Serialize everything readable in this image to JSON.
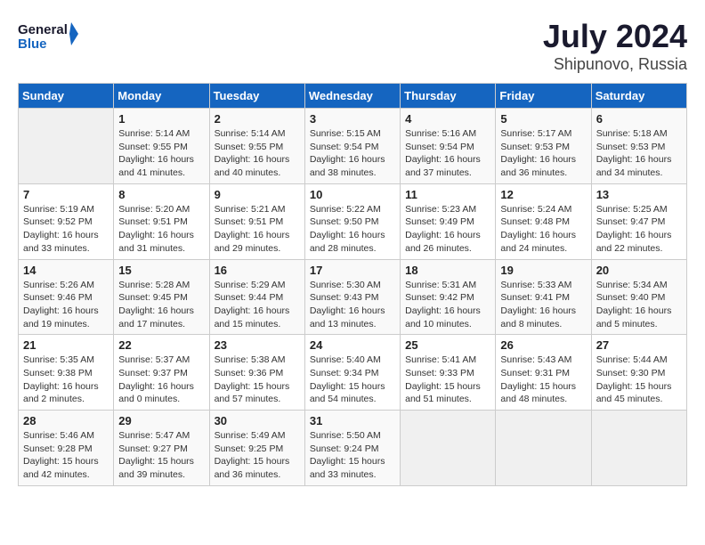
{
  "header": {
    "logo_line1": "General",
    "logo_line2": "Blue",
    "title": "July 2024",
    "subtitle": "Shipunovo, Russia"
  },
  "days_of_week": [
    "Sunday",
    "Monday",
    "Tuesday",
    "Wednesday",
    "Thursday",
    "Friday",
    "Saturday"
  ],
  "weeks": [
    [
      {
        "day": "",
        "info": ""
      },
      {
        "day": "1",
        "info": "Sunrise: 5:14 AM\nSunset: 9:55 PM\nDaylight: 16 hours\nand 41 minutes."
      },
      {
        "day": "2",
        "info": "Sunrise: 5:14 AM\nSunset: 9:55 PM\nDaylight: 16 hours\nand 40 minutes."
      },
      {
        "day": "3",
        "info": "Sunrise: 5:15 AM\nSunset: 9:54 PM\nDaylight: 16 hours\nand 38 minutes."
      },
      {
        "day": "4",
        "info": "Sunrise: 5:16 AM\nSunset: 9:54 PM\nDaylight: 16 hours\nand 37 minutes."
      },
      {
        "day": "5",
        "info": "Sunrise: 5:17 AM\nSunset: 9:53 PM\nDaylight: 16 hours\nand 36 minutes."
      },
      {
        "day": "6",
        "info": "Sunrise: 5:18 AM\nSunset: 9:53 PM\nDaylight: 16 hours\nand 34 minutes."
      }
    ],
    [
      {
        "day": "7",
        "info": "Sunrise: 5:19 AM\nSunset: 9:52 PM\nDaylight: 16 hours\nand 33 minutes."
      },
      {
        "day": "8",
        "info": "Sunrise: 5:20 AM\nSunset: 9:51 PM\nDaylight: 16 hours\nand 31 minutes."
      },
      {
        "day": "9",
        "info": "Sunrise: 5:21 AM\nSunset: 9:51 PM\nDaylight: 16 hours\nand 29 minutes."
      },
      {
        "day": "10",
        "info": "Sunrise: 5:22 AM\nSunset: 9:50 PM\nDaylight: 16 hours\nand 28 minutes."
      },
      {
        "day": "11",
        "info": "Sunrise: 5:23 AM\nSunset: 9:49 PM\nDaylight: 16 hours\nand 26 minutes."
      },
      {
        "day": "12",
        "info": "Sunrise: 5:24 AM\nSunset: 9:48 PM\nDaylight: 16 hours\nand 24 minutes."
      },
      {
        "day": "13",
        "info": "Sunrise: 5:25 AM\nSunset: 9:47 PM\nDaylight: 16 hours\nand 22 minutes."
      }
    ],
    [
      {
        "day": "14",
        "info": "Sunrise: 5:26 AM\nSunset: 9:46 PM\nDaylight: 16 hours\nand 19 minutes."
      },
      {
        "day": "15",
        "info": "Sunrise: 5:28 AM\nSunset: 9:45 PM\nDaylight: 16 hours\nand 17 minutes."
      },
      {
        "day": "16",
        "info": "Sunrise: 5:29 AM\nSunset: 9:44 PM\nDaylight: 16 hours\nand 15 minutes."
      },
      {
        "day": "17",
        "info": "Sunrise: 5:30 AM\nSunset: 9:43 PM\nDaylight: 16 hours\nand 13 minutes."
      },
      {
        "day": "18",
        "info": "Sunrise: 5:31 AM\nSunset: 9:42 PM\nDaylight: 16 hours\nand 10 minutes."
      },
      {
        "day": "19",
        "info": "Sunrise: 5:33 AM\nSunset: 9:41 PM\nDaylight: 16 hours\nand 8 minutes."
      },
      {
        "day": "20",
        "info": "Sunrise: 5:34 AM\nSunset: 9:40 PM\nDaylight: 16 hours\nand 5 minutes."
      }
    ],
    [
      {
        "day": "21",
        "info": "Sunrise: 5:35 AM\nSunset: 9:38 PM\nDaylight: 16 hours\nand 2 minutes."
      },
      {
        "day": "22",
        "info": "Sunrise: 5:37 AM\nSunset: 9:37 PM\nDaylight: 16 hours\nand 0 minutes."
      },
      {
        "day": "23",
        "info": "Sunrise: 5:38 AM\nSunset: 9:36 PM\nDaylight: 15 hours\nand 57 minutes."
      },
      {
        "day": "24",
        "info": "Sunrise: 5:40 AM\nSunset: 9:34 PM\nDaylight: 15 hours\nand 54 minutes."
      },
      {
        "day": "25",
        "info": "Sunrise: 5:41 AM\nSunset: 9:33 PM\nDaylight: 15 hours\nand 51 minutes."
      },
      {
        "day": "26",
        "info": "Sunrise: 5:43 AM\nSunset: 9:31 PM\nDaylight: 15 hours\nand 48 minutes."
      },
      {
        "day": "27",
        "info": "Sunrise: 5:44 AM\nSunset: 9:30 PM\nDaylight: 15 hours\nand 45 minutes."
      }
    ],
    [
      {
        "day": "28",
        "info": "Sunrise: 5:46 AM\nSunset: 9:28 PM\nDaylight: 15 hours\nand 42 minutes."
      },
      {
        "day": "29",
        "info": "Sunrise: 5:47 AM\nSunset: 9:27 PM\nDaylight: 15 hours\nand 39 minutes."
      },
      {
        "day": "30",
        "info": "Sunrise: 5:49 AM\nSunset: 9:25 PM\nDaylight: 15 hours\nand 36 minutes."
      },
      {
        "day": "31",
        "info": "Sunrise: 5:50 AM\nSunset: 9:24 PM\nDaylight: 15 hours\nand 33 minutes."
      },
      {
        "day": "",
        "info": ""
      },
      {
        "day": "",
        "info": ""
      },
      {
        "day": "",
        "info": ""
      }
    ]
  ]
}
